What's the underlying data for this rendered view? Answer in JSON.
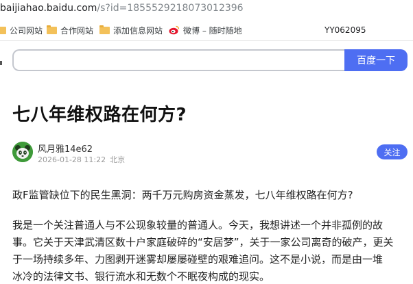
{
  "browser": {
    "url_host": "baijiahao.baidu.com",
    "url_rest": "/s?id=1855529218073012396",
    "bookmarks": [
      {
        "label": "公司网站",
        "icon": "folder-icon"
      },
      {
        "label": "合作网站",
        "icon": "folder-icon"
      },
      {
        "label": "添加信息网站",
        "icon": "folder-icon"
      },
      {
        "label": "微博 – 随时随地",
        "icon": "weibo-icon"
      }
    ],
    "bookmark_tag": "YY062095"
  },
  "search": {
    "button_label": "百度一下",
    "query": ""
  },
  "article": {
    "title": "七八年维权路在何方?",
    "author": "风月雅14e62",
    "date": "2026-01-28 11:22",
    "location": "北京",
    "follow_label": "关注",
    "lead": "政F监管缺位下的民生黑洞：两千万元购房资金蒸发，七八年维权路在何方?",
    "body_lines": [
      "我是一个关注普通人与不公现象较量的普通人。今天，我想讲述一个并非孤例的故",
      "事。它关于天津武清区数十户家庭破碎的“安居梦”，关于一家公司离奇的破产，更关",
      "于一场持续多年、力图剥开迷雾却屡屡碰壁的艰难追问。这不是小说，而是由一堆",
      "冰冷的法律文书、银行流水和无数个不眠夜构成的现实。"
    ]
  },
  "colors": {
    "accent": "#4e6ef2",
    "folder": "#f3c15a",
    "avatar": "#3f9a3a"
  }
}
